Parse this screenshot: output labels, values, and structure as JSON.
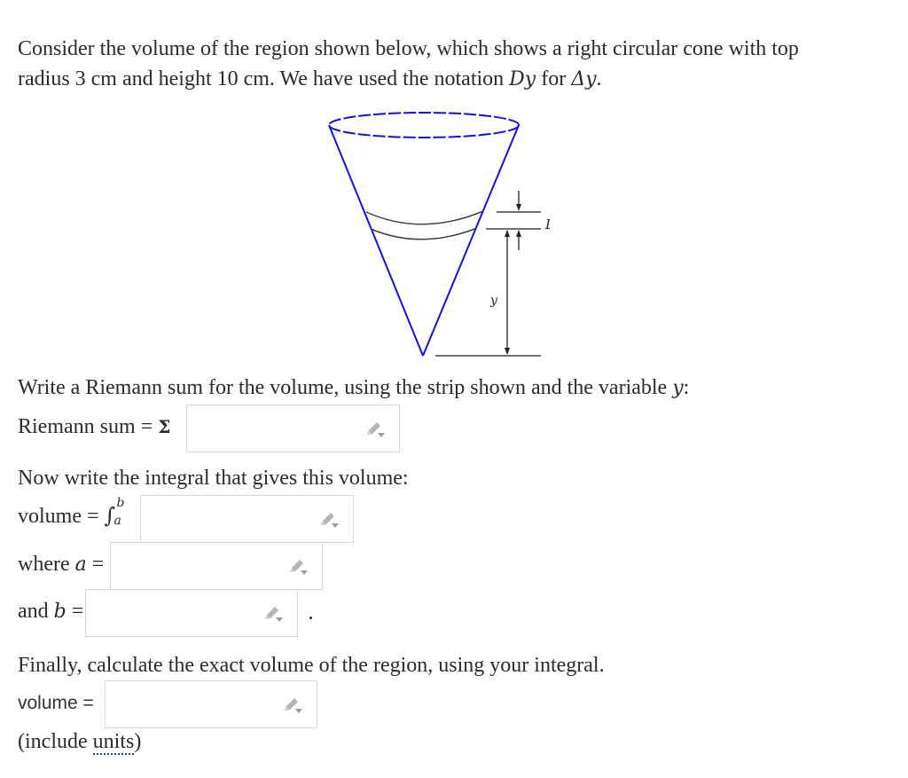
{
  "intro": {
    "line1": "Consider the volume of the region shown below, which shows a right circular cone with top",
    "line2_prefix": "radius 3 cm and height 10 cm. We have used the notation ",
    "line2_var": "Dy",
    "line2_mid": " for ",
    "line2_delta": "Δy",
    "line2_end": "."
  },
  "figure": {
    "label_dy": "Dy",
    "label_y": "y",
    "cone_color": "#1010ee",
    "strip_color": "#404040"
  },
  "riemann": {
    "prompt_prefix": "Write a Riemann sum for the volume, using the strip shown and the variable ",
    "prompt_var": "y",
    "prompt_end": ":",
    "label": "Riemann sum = ",
    "sigma": "Σ",
    "input_value": ""
  },
  "integral": {
    "prompt": "Now write the integral that gives this volume:",
    "label": "volume = ",
    "integral_sign": "∫",
    "upper_limit": "b",
    "lower_limit": "a",
    "input_value": ""
  },
  "limit_a": {
    "label_prefix": "where ",
    "label_var": "a",
    "label_eq": " =",
    "input_value": ""
  },
  "limit_b": {
    "label_prefix": "and ",
    "label_var": "b",
    "label_eq": " =",
    "input_value": "",
    "trailing": "."
  },
  "final": {
    "prompt": "Finally, calculate the exact volume of the region, using your integral.",
    "label": "volume =",
    "input_value": "",
    "note_prefix": "(include ",
    "note_link": "units",
    "note_end": ")"
  },
  "icons": {
    "input_tool": "pencil-dropdown-icon"
  },
  "colors": {
    "input_border": "#d8d8d8",
    "icon_gray": "#b5b5b5",
    "link_dots": "#1a3dbd"
  }
}
